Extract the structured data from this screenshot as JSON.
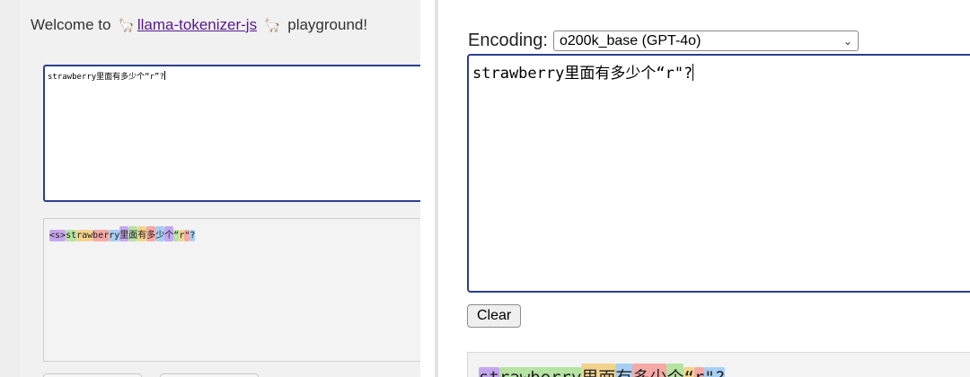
{
  "left": {
    "header_prefix": "Welcome to",
    "llama_emoji": "🦙",
    "link_text": "llama-tokenizer-js",
    "header_suffix": "playground!",
    "input_value": "strawberry里面有多少个“r”?",
    "tokens": [
      {
        "text": "<s>",
        "color": "#c5a6ee"
      },
      {
        "text": " ",
        "color": "transparent"
      },
      {
        "text": "st",
        "color": "#b6e3a3"
      },
      {
        "text": "raw",
        "color": "#f3d48d"
      },
      {
        "text": "ber",
        "color": "#f4a9a6"
      },
      {
        "text": "ry",
        "color": "#a6cff3"
      },
      {
        "text": "里",
        "color": "#c5a6ee"
      },
      {
        "text": "面",
        "color": "#b6e3a3"
      },
      {
        "text": "有",
        "color": "#f3d48d"
      },
      {
        "text": "多",
        "color": "#f4a9a6"
      },
      {
        "text": "少",
        "color": "#a6cff3"
      },
      {
        "text": "个",
        "color": "#c5a6ee"
      },
      {
        "text": "“",
        "color": "#b6e3a3"
      },
      {
        "text": "r",
        "color": "#f3d48d"
      },
      {
        "text": "\"",
        "color": "#f4a9a6"
      },
      {
        "text": "?",
        "color": "#a6cff3"
      }
    ]
  },
  "right": {
    "encoding_label": "Encoding:",
    "encoding_selected": "o200k_base (GPT-4o)",
    "input_value": "strawberry里面有多少个“r\"?",
    "clear_label": "Clear",
    "tokens": [
      {
        "text": "st",
        "color": "#c5a6ee"
      },
      {
        "text": "rawberry",
        "color": "#b6e3a3"
      },
      {
        "text": "里面",
        "color": "#f3d48d"
      },
      {
        "text": "有",
        "color": "#a6cff3"
      },
      {
        "text": "多少",
        "color": "#f4a9a6"
      },
      {
        "text": "个",
        "color": "#b6e3a3"
      },
      {
        "text": "“",
        "color": "#f3d48d"
      },
      {
        "text": "r",
        "color": "#f4a9a6"
      },
      {
        "text": "\"?",
        "color": "#a6cff3"
      }
    ]
  }
}
